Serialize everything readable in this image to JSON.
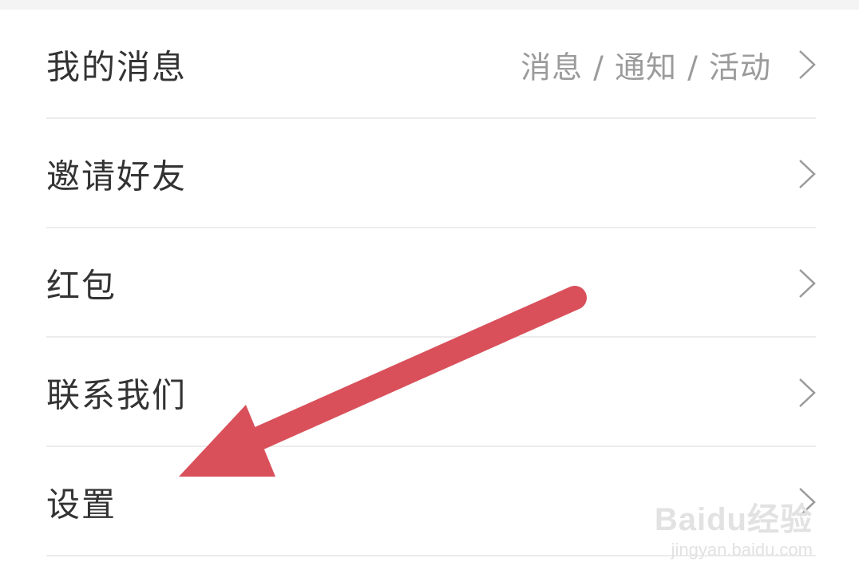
{
  "menu": {
    "items": [
      {
        "label": "我的消息",
        "sub": "消息 / 通知 / 活动"
      },
      {
        "label": "邀请好友",
        "sub": ""
      },
      {
        "label": "红包",
        "sub": ""
      },
      {
        "label": "联系我们",
        "sub": ""
      },
      {
        "label": "设置",
        "sub": ""
      }
    ]
  },
  "icons": {
    "chevron": "chevron-right-icon"
  },
  "annotation": {
    "arrow_color": "#d9505a"
  },
  "watermark": {
    "logo_text": "Baidu经验",
    "url": "jingyan.baidu.com"
  }
}
